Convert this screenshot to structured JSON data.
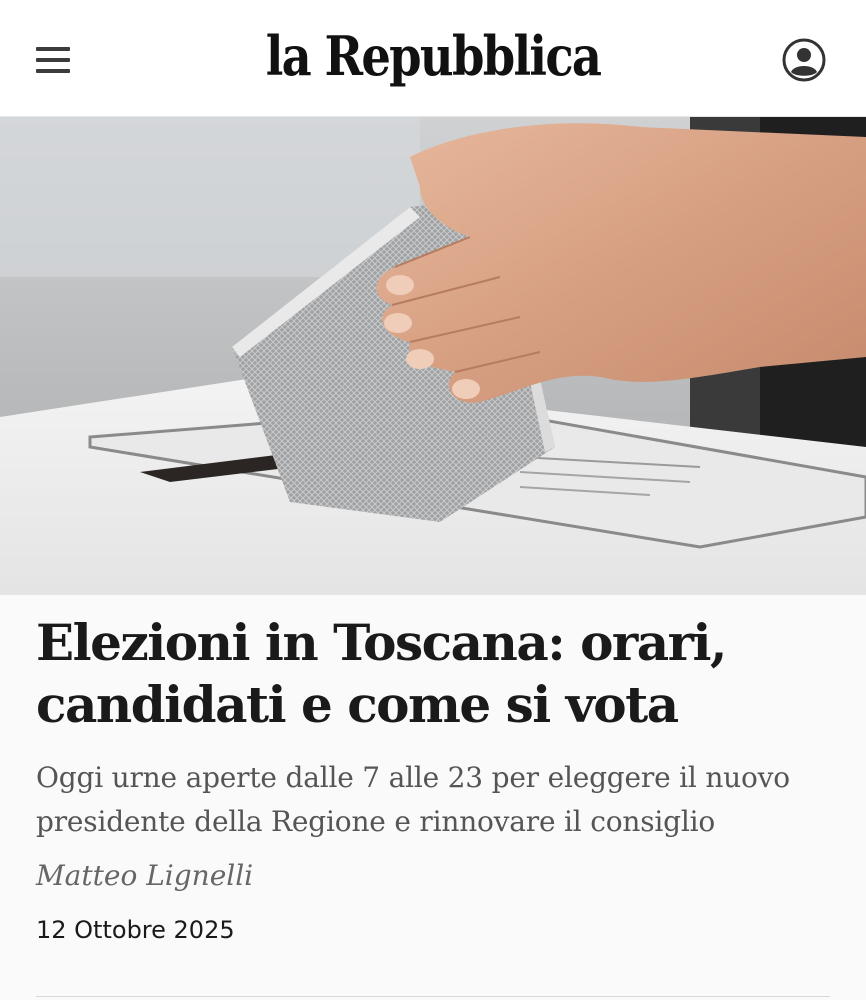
{
  "header": {
    "logo": "la Repubblica",
    "menu_icon": "hamburger-menu-icon",
    "user_icon": "user-account-icon"
  },
  "hero": {
    "image_subject": "ballot-box-photo"
  },
  "article": {
    "headline": "Elezioni in Toscana: orari, candidati e come si vota",
    "summary": "Oggi urne aperte dalle 7 alle 23 per eleggere il nuovo presidente della Regione e rinnovare il consiglio",
    "author": "Matteo Lignelli",
    "date": "12 Ottobre 2025"
  },
  "colors": {
    "text": "#1a1a1a",
    "summary": "#555555",
    "header_bg": "#ffffff"
  }
}
